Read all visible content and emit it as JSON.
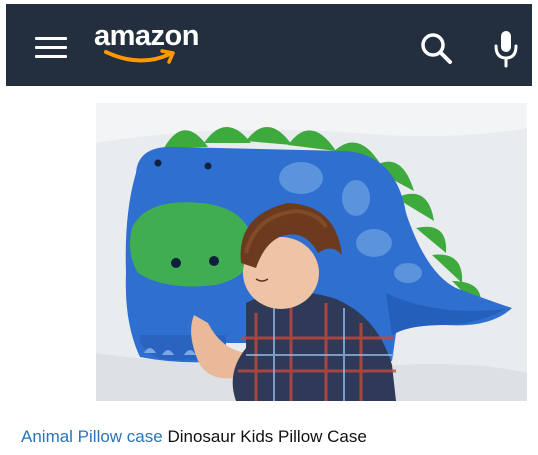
{
  "header": {
    "logo_text": "amazon",
    "colors": {
      "background": "#232f3e",
      "smile": "#ff9900"
    },
    "icons": [
      "menu-icon",
      "search-icon",
      "microphone-icon"
    ]
  },
  "product": {
    "image_alt": "Boy sleeping on a blue dinosaur shaped pillow with green spikes",
    "category_link": "Animal Pillow case",
    "title": "Dinosaur Kids Pillow Case",
    "colors": {
      "link": "#2a74b8"
    }
  }
}
